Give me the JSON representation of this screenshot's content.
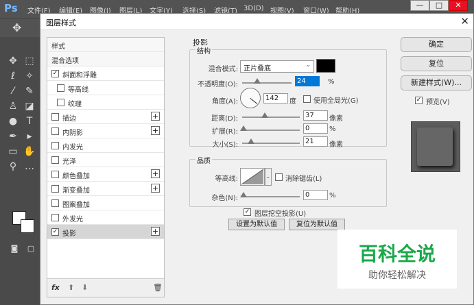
{
  "app": {
    "logo": "Ps",
    "menu": [
      "文件(F)",
      "编辑(E)",
      "图像(I)",
      "图层(L)",
      "文字(Y)",
      "选择(S)",
      "滤镜(T)",
      "3D(D)",
      "视图(V)",
      "窗口(W)",
      "帮助(H)"
    ],
    "window_controls": [
      "—",
      "□",
      "✕"
    ]
  },
  "dialog": {
    "title": "图层样式",
    "close": "✕"
  },
  "styles_list": {
    "items": [
      {
        "label": "样式",
        "checkbox": false,
        "checked": false,
        "plus": false,
        "header": true
      },
      {
        "label": "混合选项",
        "checkbox": false,
        "checked": false,
        "plus": false,
        "header": true
      },
      {
        "label": "斜面和浮雕",
        "checkbox": true,
        "checked": true,
        "plus": false
      },
      {
        "label": "等高线",
        "checkbox": true,
        "checked": false,
        "plus": false,
        "indent": true
      },
      {
        "label": "纹理",
        "checkbox": true,
        "checked": false,
        "plus": false,
        "indent": true
      },
      {
        "label": "描边",
        "checkbox": true,
        "checked": false,
        "plus": true
      },
      {
        "label": "内阴影",
        "checkbox": true,
        "checked": false,
        "plus": true
      },
      {
        "label": "内发光",
        "checkbox": true,
        "checked": false,
        "plus": false
      },
      {
        "label": "光泽",
        "checkbox": true,
        "checked": false,
        "plus": false
      },
      {
        "label": "颜色叠加",
        "checkbox": true,
        "checked": false,
        "plus": true
      },
      {
        "label": "渐变叠加",
        "checkbox": true,
        "checked": false,
        "plus": true
      },
      {
        "label": "图案叠加",
        "checkbox": true,
        "checked": false,
        "plus": false
      },
      {
        "label": "外发光",
        "checkbox": true,
        "checked": false,
        "plus": false
      },
      {
        "label": "投影",
        "checkbox": true,
        "checked": true,
        "plus": true,
        "selected": true
      }
    ],
    "footer_fx": "fx",
    "footer_icons": [
      "up-arrow",
      "down-arrow",
      "trash"
    ]
  },
  "drop_shadow": {
    "section_title": "投影",
    "structure_title": "结构",
    "blend_mode_label": "混合模式:",
    "blend_mode_value": "正片叠底",
    "blend_color": "#000000",
    "opacity_label": "不透明度(O):",
    "opacity_value": "24",
    "opacity_unit": "%",
    "angle_label": "角度(A):",
    "angle_value": "142",
    "angle_unit": "度",
    "global_light_label": "使用全局光(G)",
    "global_light_checked": false,
    "distance_label": "距离(D):",
    "distance_value": "37",
    "distance_unit": "像素",
    "spread_label": "扩展(R):",
    "spread_value": "0",
    "spread_unit": "%",
    "size_label": "大小(S):",
    "size_value": "21",
    "size_unit": "像素",
    "quality_title": "品质",
    "contour_label": "等高线:",
    "antialias_label": "消除锯齿(L)",
    "antialias_checked": false,
    "noise_label": "杂色(N):",
    "noise_value": "0",
    "noise_unit": "%",
    "knockout_label": "图层挖空投影(U)",
    "knockout_checked": true,
    "set_default_label": "设置为默认值",
    "reset_default_label": "复位为默认值"
  },
  "buttons": {
    "ok": "确定",
    "reset": "复位",
    "new_style": "新建样式(W)...",
    "preview_label": "预览(V)",
    "preview_checked": true
  },
  "watermark": {
    "title": "百科全说",
    "subtitle": "助你轻松解决"
  }
}
